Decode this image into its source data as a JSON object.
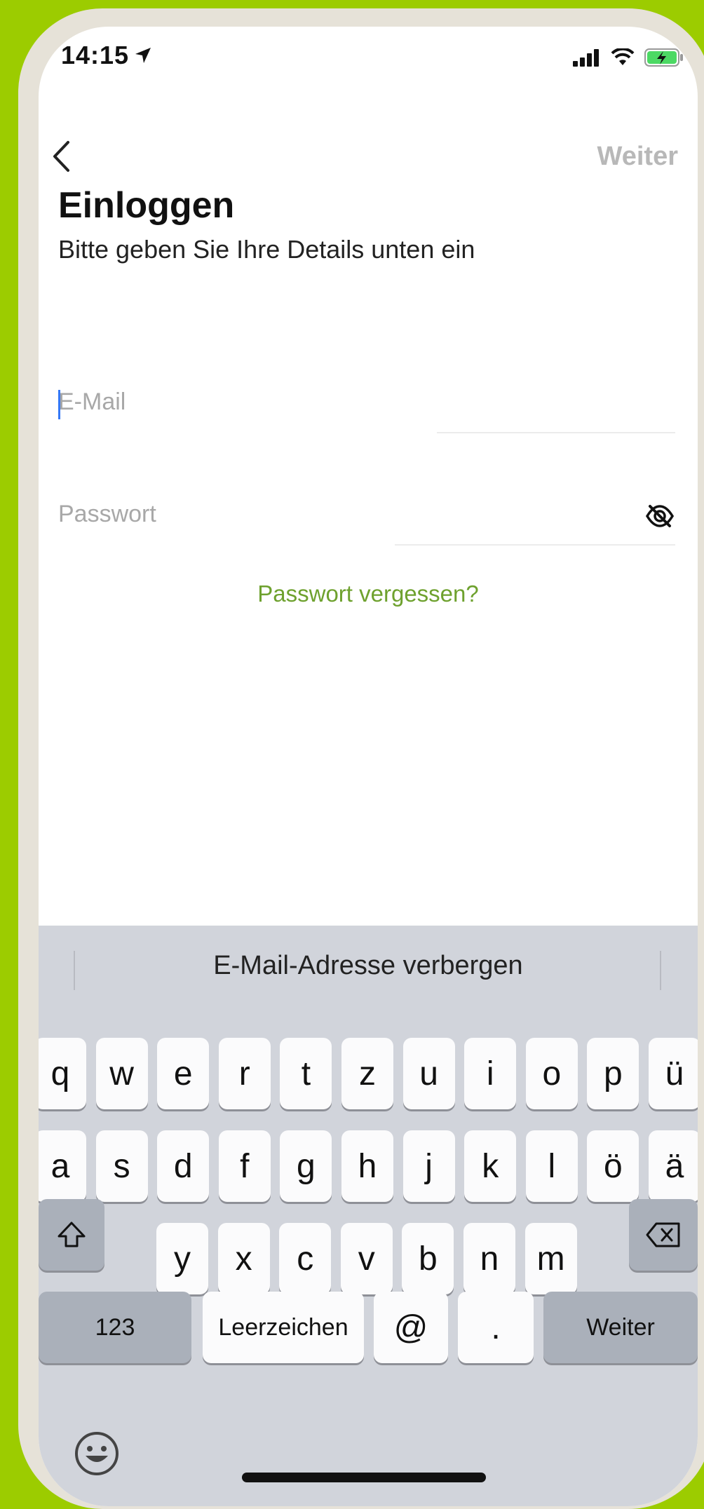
{
  "status_bar": {
    "time": "14:15"
  },
  "nav": {
    "next_label": "Weiter"
  },
  "header": {
    "title": "Einloggen",
    "subtitle": "Bitte geben Sie Ihre Details unten ein"
  },
  "form": {
    "email_placeholder": "E-Mail",
    "password_placeholder": "Passwort",
    "forgot_label": "Passwort vergessen?"
  },
  "keyboard": {
    "suggestion": "E-Mail-Adresse verbergen",
    "row1": [
      "q",
      "w",
      "e",
      "r",
      "t",
      "z",
      "u",
      "i",
      "o",
      "p",
      "ü"
    ],
    "row2": [
      "a",
      "s",
      "d",
      "f",
      "g",
      "h",
      "j",
      "k",
      "l",
      "ö",
      "ä"
    ],
    "row3": [
      "y",
      "x",
      "c",
      "v",
      "b",
      "n",
      "m"
    ],
    "numbers_label": "123",
    "space_label": "Leerzeichen",
    "at_label": "@",
    "dot_label": ".",
    "return_label": "Weiter"
  },
  "colors": {
    "background": "#9ccc00",
    "accent_green": "#6ea12e",
    "caret": "#3478f6"
  }
}
